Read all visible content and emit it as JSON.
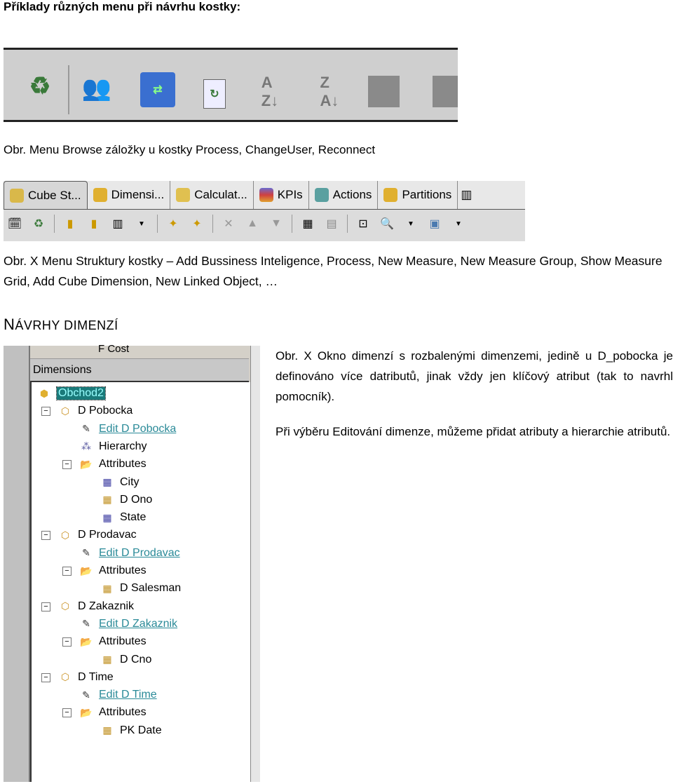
{
  "heading": "Příklady různých menu při návrhu kostky:",
  "caption1": "Obr. Menu Browse záložky u kostky Process, ChangeUser, Reconnect",
  "browse_toolbar": {
    "icons": [
      "process-icon",
      "change-user-icon",
      "reconnect-icon",
      "refresh-icon",
      "sort-ascending-icon",
      "sort-descending-icon",
      "filter-icon",
      "filter-icon-2"
    ]
  },
  "structure": {
    "tabs": [
      {
        "label": "Cube St...",
        "icon": "cube-structure-icon"
      },
      {
        "label": "Dimensi...",
        "icon": "dimension-icon"
      },
      {
        "label": "Calculat...",
        "icon": "calculation-icon"
      },
      {
        "label": "KPIs",
        "icon": "kpi-icon"
      },
      {
        "label": "Actions",
        "icon": "actions-icon"
      },
      {
        "label": "Partitions",
        "icon": "partitions-icon"
      }
    ]
  },
  "caption2": "Obr. X Menu Struktury kostky – Add Bussiness Inteligence, Process, New Measure, New Measure Group, Show Measure Grid, Add Cube Dimension, New Linked Object, …",
  "section_title_first": "N",
  "section_title_rest": "ÁVRHY DIMENZÍ",
  "tree": {
    "above_item": "F Cost",
    "header": "Dimensions",
    "items": [
      {
        "label": "Obchod2",
        "level": 0,
        "type": "cube",
        "selected": true
      },
      {
        "label": "D Pobocka",
        "level": 1,
        "type": "dimension",
        "expanded": true
      },
      {
        "label": "Edit D Pobocka",
        "level": 2,
        "type": "edit-link"
      },
      {
        "label": "Hierarchy",
        "level": 2,
        "type": "hierarchy"
      },
      {
        "label": "Attributes",
        "level": 2,
        "type": "folder",
        "expanded": true
      },
      {
        "label": "City",
        "level": 3,
        "type": "attribute"
      },
      {
        "label": "D Ono",
        "level": 3,
        "type": "key-attribute"
      },
      {
        "label": "State",
        "level": 3,
        "type": "attribute"
      },
      {
        "label": "D Prodavac",
        "level": 1,
        "type": "dimension",
        "expanded": true
      },
      {
        "label": "Edit D Prodavac",
        "level": 2,
        "type": "edit-link"
      },
      {
        "label": "Attributes",
        "level": 2,
        "type": "folder",
        "expanded": true
      },
      {
        "label": "D Salesman",
        "level": 3,
        "type": "key-attribute"
      },
      {
        "label": "D Zakaznik",
        "level": 1,
        "type": "dimension",
        "expanded": true
      },
      {
        "label": "Edit D Zakaznik",
        "level": 2,
        "type": "edit-link"
      },
      {
        "label": "Attributes",
        "level": 2,
        "type": "folder",
        "expanded": true
      },
      {
        "label": "D Cno",
        "level": 3,
        "type": "key-attribute"
      },
      {
        "label": "D Time",
        "level": 1,
        "type": "dimension",
        "expanded": true
      },
      {
        "label": "Edit D Time",
        "level": 2,
        "type": "edit-link"
      },
      {
        "label": "Attributes",
        "level": 2,
        "type": "folder",
        "expanded": true
      },
      {
        "label": "PK Date",
        "level": 3,
        "type": "key-attribute"
      }
    ]
  },
  "para1": "Obr. X Okno dimenzí s rozbalenými dimenzemi, jedině u D_pobocka je definováno více datributů, jinak vždy jen klíčový atribut (tak to navrhl pomocník).",
  "para2": "Při výběru Editování dimenze, můžeme přidat atributy a hierarchie atributů.",
  "colors": {
    "link": "#2a8a98",
    "selection": "#1a7a7a",
    "toolbar": "#cfcfcf"
  }
}
